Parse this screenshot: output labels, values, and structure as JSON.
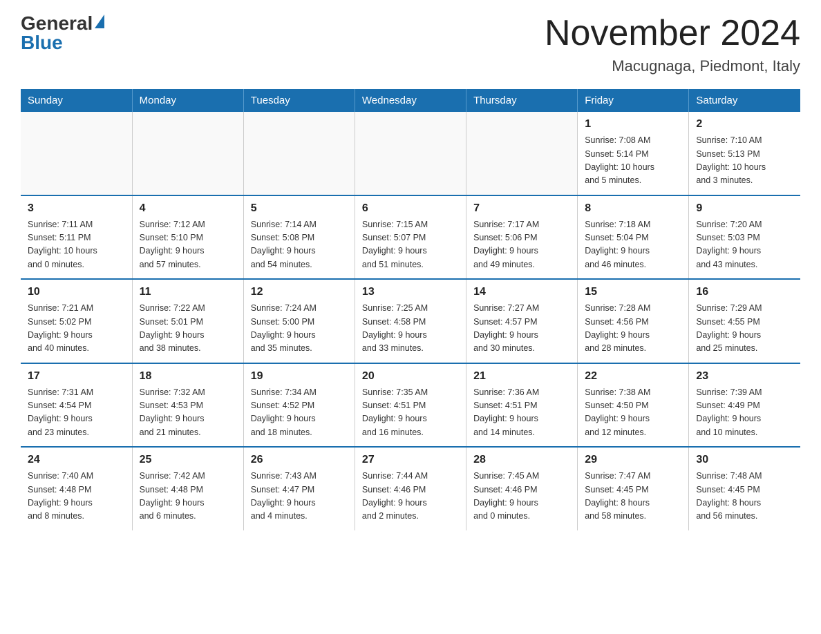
{
  "header": {
    "logo_general": "General",
    "logo_blue": "Blue",
    "month_title": "November 2024",
    "location": "Macugnaga, Piedmont, Italy"
  },
  "weekdays": [
    "Sunday",
    "Monday",
    "Tuesday",
    "Wednesday",
    "Thursday",
    "Friday",
    "Saturday"
  ],
  "weeks": [
    [
      {
        "day": "",
        "info": ""
      },
      {
        "day": "",
        "info": ""
      },
      {
        "day": "",
        "info": ""
      },
      {
        "day": "",
        "info": ""
      },
      {
        "day": "",
        "info": ""
      },
      {
        "day": "1",
        "info": "Sunrise: 7:08 AM\nSunset: 5:14 PM\nDaylight: 10 hours\nand 5 minutes."
      },
      {
        "day": "2",
        "info": "Sunrise: 7:10 AM\nSunset: 5:13 PM\nDaylight: 10 hours\nand 3 minutes."
      }
    ],
    [
      {
        "day": "3",
        "info": "Sunrise: 7:11 AM\nSunset: 5:11 PM\nDaylight: 10 hours\nand 0 minutes."
      },
      {
        "day": "4",
        "info": "Sunrise: 7:12 AM\nSunset: 5:10 PM\nDaylight: 9 hours\nand 57 minutes."
      },
      {
        "day": "5",
        "info": "Sunrise: 7:14 AM\nSunset: 5:08 PM\nDaylight: 9 hours\nand 54 minutes."
      },
      {
        "day": "6",
        "info": "Sunrise: 7:15 AM\nSunset: 5:07 PM\nDaylight: 9 hours\nand 51 minutes."
      },
      {
        "day": "7",
        "info": "Sunrise: 7:17 AM\nSunset: 5:06 PM\nDaylight: 9 hours\nand 49 minutes."
      },
      {
        "day": "8",
        "info": "Sunrise: 7:18 AM\nSunset: 5:04 PM\nDaylight: 9 hours\nand 46 minutes."
      },
      {
        "day": "9",
        "info": "Sunrise: 7:20 AM\nSunset: 5:03 PM\nDaylight: 9 hours\nand 43 minutes."
      }
    ],
    [
      {
        "day": "10",
        "info": "Sunrise: 7:21 AM\nSunset: 5:02 PM\nDaylight: 9 hours\nand 40 minutes."
      },
      {
        "day": "11",
        "info": "Sunrise: 7:22 AM\nSunset: 5:01 PM\nDaylight: 9 hours\nand 38 minutes."
      },
      {
        "day": "12",
        "info": "Sunrise: 7:24 AM\nSunset: 5:00 PM\nDaylight: 9 hours\nand 35 minutes."
      },
      {
        "day": "13",
        "info": "Sunrise: 7:25 AM\nSunset: 4:58 PM\nDaylight: 9 hours\nand 33 minutes."
      },
      {
        "day": "14",
        "info": "Sunrise: 7:27 AM\nSunset: 4:57 PM\nDaylight: 9 hours\nand 30 minutes."
      },
      {
        "day": "15",
        "info": "Sunrise: 7:28 AM\nSunset: 4:56 PM\nDaylight: 9 hours\nand 28 minutes."
      },
      {
        "day": "16",
        "info": "Sunrise: 7:29 AM\nSunset: 4:55 PM\nDaylight: 9 hours\nand 25 minutes."
      }
    ],
    [
      {
        "day": "17",
        "info": "Sunrise: 7:31 AM\nSunset: 4:54 PM\nDaylight: 9 hours\nand 23 minutes."
      },
      {
        "day": "18",
        "info": "Sunrise: 7:32 AM\nSunset: 4:53 PM\nDaylight: 9 hours\nand 21 minutes."
      },
      {
        "day": "19",
        "info": "Sunrise: 7:34 AM\nSunset: 4:52 PM\nDaylight: 9 hours\nand 18 minutes."
      },
      {
        "day": "20",
        "info": "Sunrise: 7:35 AM\nSunset: 4:51 PM\nDaylight: 9 hours\nand 16 minutes."
      },
      {
        "day": "21",
        "info": "Sunrise: 7:36 AM\nSunset: 4:51 PM\nDaylight: 9 hours\nand 14 minutes."
      },
      {
        "day": "22",
        "info": "Sunrise: 7:38 AM\nSunset: 4:50 PM\nDaylight: 9 hours\nand 12 minutes."
      },
      {
        "day": "23",
        "info": "Sunrise: 7:39 AM\nSunset: 4:49 PM\nDaylight: 9 hours\nand 10 minutes."
      }
    ],
    [
      {
        "day": "24",
        "info": "Sunrise: 7:40 AM\nSunset: 4:48 PM\nDaylight: 9 hours\nand 8 minutes."
      },
      {
        "day": "25",
        "info": "Sunrise: 7:42 AM\nSunset: 4:48 PM\nDaylight: 9 hours\nand 6 minutes."
      },
      {
        "day": "26",
        "info": "Sunrise: 7:43 AM\nSunset: 4:47 PM\nDaylight: 9 hours\nand 4 minutes."
      },
      {
        "day": "27",
        "info": "Sunrise: 7:44 AM\nSunset: 4:46 PM\nDaylight: 9 hours\nand 2 minutes."
      },
      {
        "day": "28",
        "info": "Sunrise: 7:45 AM\nSunset: 4:46 PM\nDaylight: 9 hours\nand 0 minutes."
      },
      {
        "day": "29",
        "info": "Sunrise: 7:47 AM\nSunset: 4:45 PM\nDaylight: 8 hours\nand 58 minutes."
      },
      {
        "day": "30",
        "info": "Sunrise: 7:48 AM\nSunset: 4:45 PM\nDaylight: 8 hours\nand 56 minutes."
      }
    ]
  ]
}
